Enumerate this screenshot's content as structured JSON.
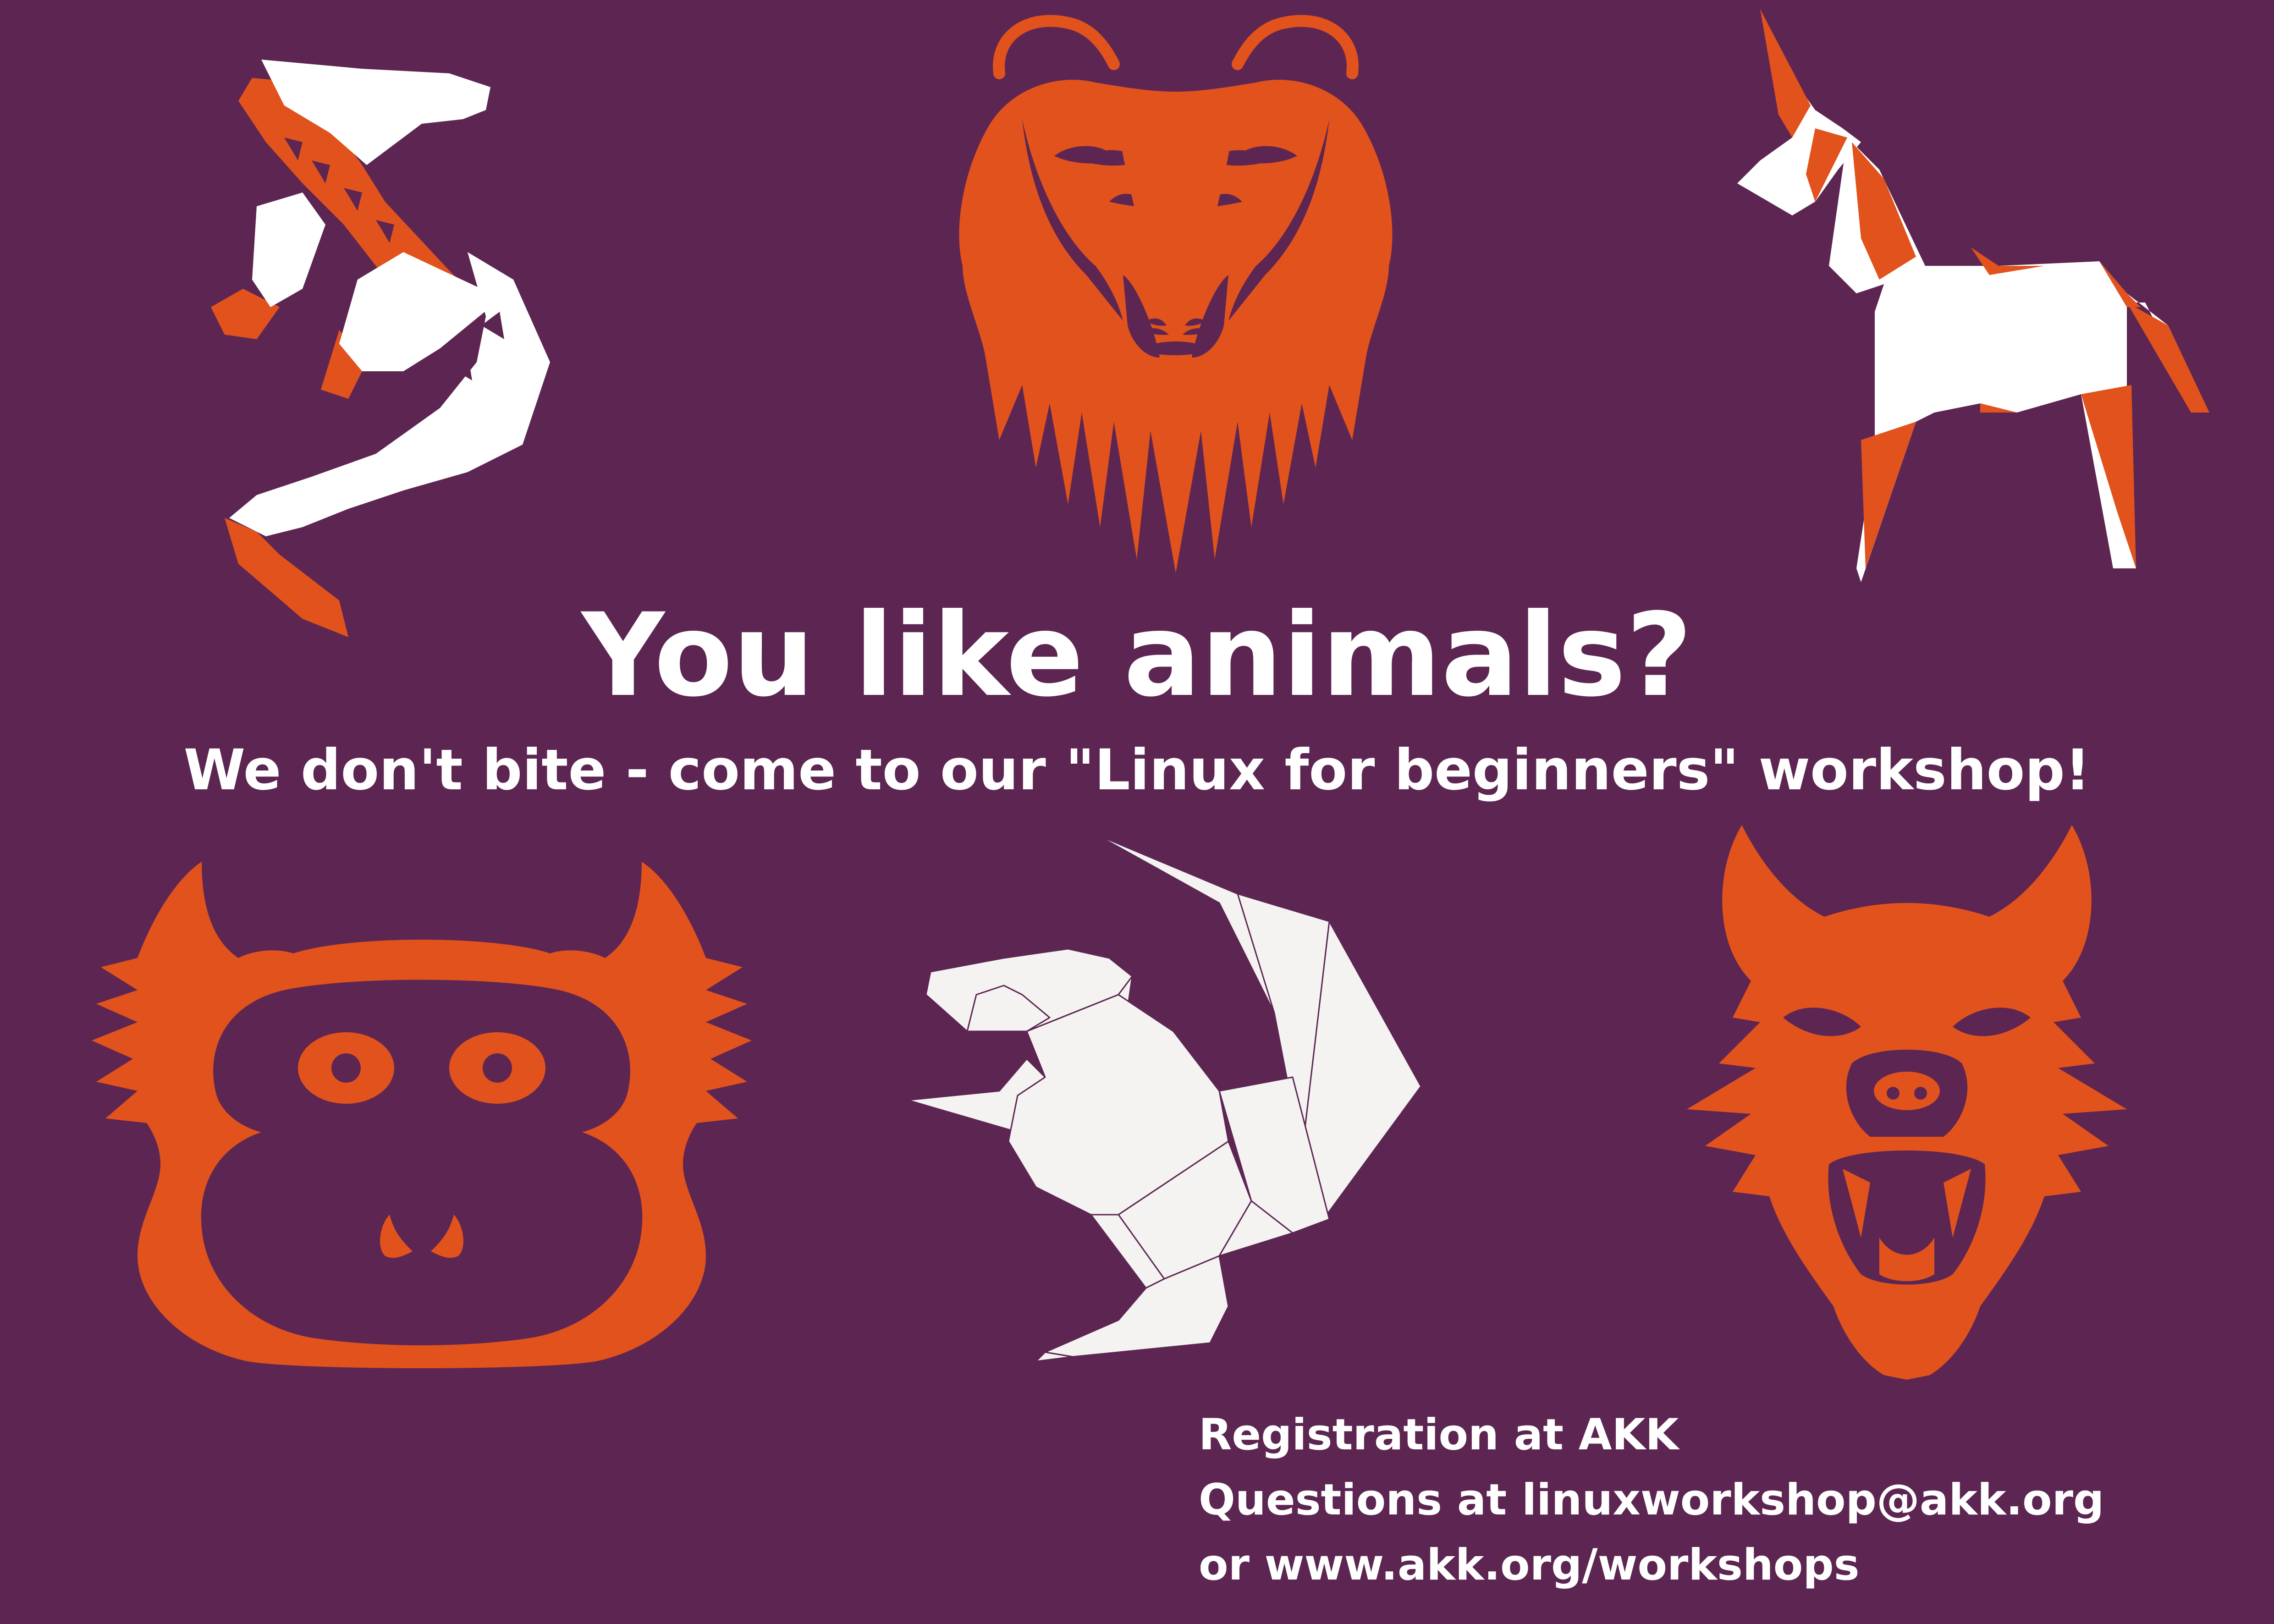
{
  "poster": {
    "title": "You like animals?",
    "subtitle": "We don't bite - come to our \"Linux for beginners\" workshop!",
    "info_lines": [
      "Registration at AKK",
      "Questions at linuxworkshop@akk.org",
      "or www.akk.org/workshops"
    ]
  },
  "colors": {
    "background": "#5d2652",
    "orange": "#e2521c",
    "orange_light": "#e86432",
    "white": "#ffffff",
    "paper": "#f4f3f2"
  },
  "illustrations": [
    "lizard-icon",
    "gnu-icon",
    "unicorn-icon",
    "monkey-icon",
    "squirrel-icon",
    "wolf-icon"
  ]
}
